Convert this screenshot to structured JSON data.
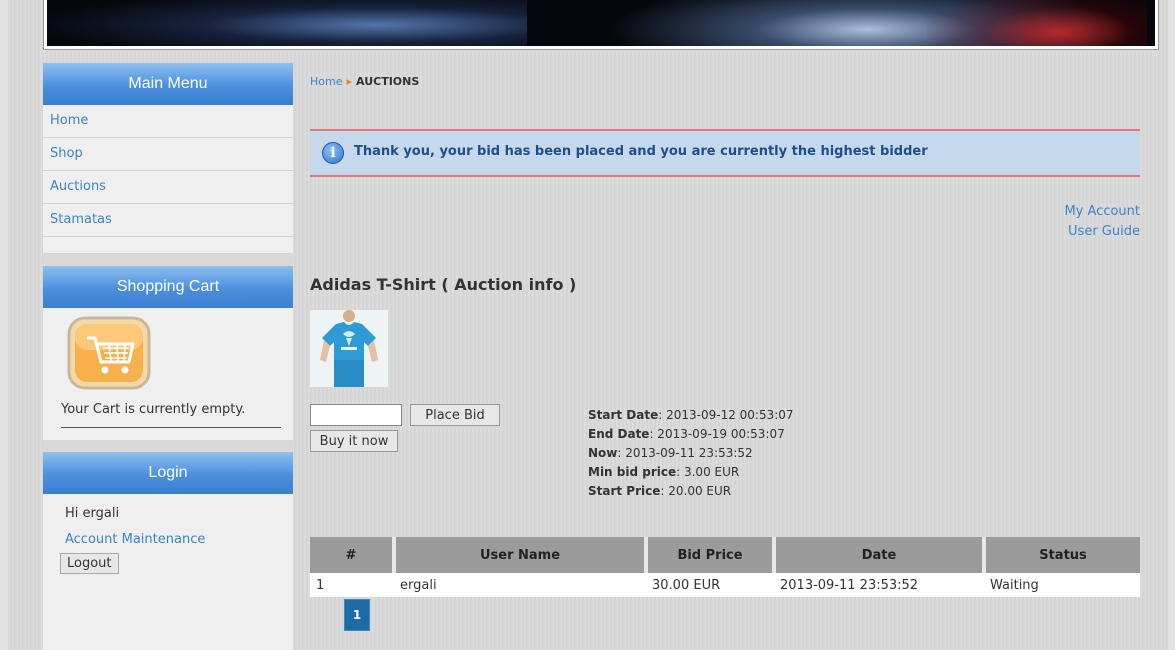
{
  "sidebar": {
    "main_menu": {
      "title": "Main Menu",
      "items": [
        {
          "label": "Home"
        },
        {
          "label": "Shop"
        },
        {
          "label": "Auctions"
        },
        {
          "label": "Stamatas"
        }
      ]
    },
    "shopping_cart": {
      "title": "Shopping Cart",
      "empty_text": "Your Cart is currently empty."
    },
    "login": {
      "title": "Login",
      "greeting": "Hi ergali",
      "account_link": "Account Maintenance",
      "logout_label": "Logout"
    }
  },
  "breadcrumb": {
    "home": "Home",
    "current": "AUCTIONS"
  },
  "notice": {
    "icon": "info-icon",
    "message": "Thank you, your bid has been placed and you are currently the highest bidder"
  },
  "top_links": {
    "my_account": "My Account",
    "user_guide": "User Guide"
  },
  "auction": {
    "title": "Adidas T-Shirt ( Auction info )",
    "bid_value": "",
    "place_bid_label": "Place Bid",
    "buy_now_label": "Buy it now",
    "details": {
      "start_date_label": "Start Date",
      "start_date": ": 2013-09-12 00:53:07",
      "end_date_label": "End Date",
      "end_date": ": 2013-09-19 00:53:07",
      "now_label": "Now",
      "now": ": 2013-09-11 23:53:52",
      "min_bid_label": "Min bid price",
      "min_bid": ": 3.00 EUR",
      "start_price_label": "Start Price",
      "start_price": ": 20.00 EUR"
    }
  },
  "bids_table": {
    "headers": [
      "#",
      "User Name",
      "Bid Price",
      "Date",
      "Status"
    ],
    "rows": [
      [
        "1",
        "ergali",
        "30.00 EUR",
        "2013-09-11 23:53:52",
        "Waiting"
      ]
    ]
  },
  "pagination": {
    "current_page": "1"
  },
  "colors": {
    "accent_blue": "#3a85c8",
    "header_gradient": "#4b8fdc",
    "notice_border": "#e0787a",
    "notice_bg": "#c6d8ec"
  }
}
